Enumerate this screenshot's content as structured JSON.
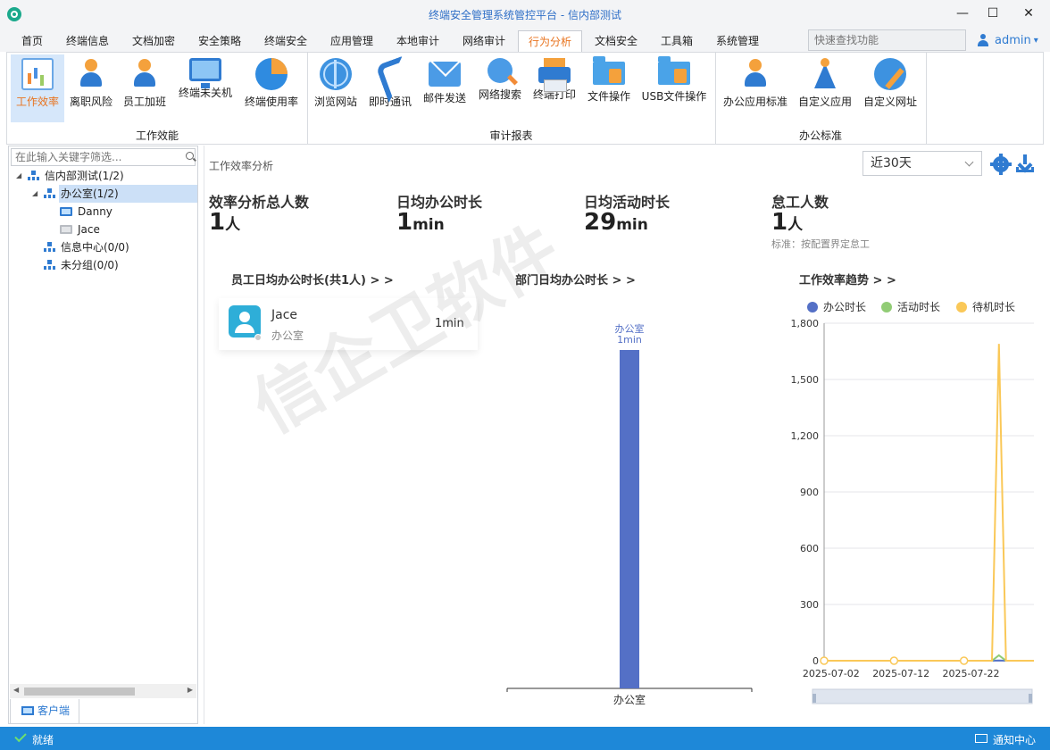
{
  "window": {
    "title": "终端安全管理系统管控平台 - 信内部测试",
    "minimize": "—",
    "maximize": "☐",
    "close": "✕"
  },
  "menu": {
    "items": [
      "首页",
      "终端信息",
      "文档加密",
      "安全策略",
      "终端安全",
      "应用管理",
      "本地审计",
      "网络审计",
      "行为分析",
      "文档安全",
      "工具箱",
      "系统管理"
    ],
    "active": "行为分析",
    "search_placeholder": "快速查找功能",
    "user": "admin",
    "user_caret": "▾"
  },
  "ribbon": {
    "groups": [
      {
        "label": "工作效能",
        "buttons": [
          "工作效率",
          "离职风险",
          "员工加班",
          "终端未关机",
          "终端使用率"
        ]
      },
      {
        "label": "审计报表",
        "buttons": [
          "浏览网站",
          "即时通讯",
          "邮件发送",
          "网络搜索",
          "终端打印",
          "文件操作",
          "USB文件操作"
        ]
      },
      {
        "label": "办公标准",
        "buttons": [
          "办公应用标准",
          "自定义应用",
          "自定义网址"
        ]
      }
    ],
    "active_button": "工作效率"
  },
  "tree": {
    "filter_placeholder": "在此输入关键字筛选...",
    "nodes": [
      {
        "label": "信内部测试(1/2)",
        "type": "org",
        "expanded": true
      },
      {
        "label": "办公室(1/2)",
        "type": "org",
        "expanded": true,
        "selected": true
      },
      {
        "label": "Danny",
        "type": "pc",
        "online": true
      },
      {
        "label": "Jace",
        "type": "pc",
        "online": false
      },
      {
        "label": "信息中心(0/0)",
        "type": "org"
      },
      {
        "label": "未分组(0/0)",
        "type": "org"
      }
    ],
    "caret_expanded": "◢",
    "scroll_left": "◀",
    "scroll_right": "▶",
    "client_tab": "客户端"
  },
  "content": {
    "title": "工作效率分析",
    "range": "近30天",
    "stats": [
      {
        "label": "效率分析总人数",
        "value": "1",
        "unit": "人"
      },
      {
        "label": "日均办公时长",
        "value": "1",
        "unit": "min"
      },
      {
        "label": "日均活动时长",
        "value": "29",
        "unit": "min"
      },
      {
        "label": "怠工人数",
        "value": "1",
        "unit": "人"
      }
    ],
    "slack_note": "标准：按配置界定怠工",
    "sections": {
      "employee": "员工日均办公时长(共1人) > >",
      "department": "部门日均办公时长 > >",
      "trend": "工作效率趋势 > >"
    },
    "employee_card": {
      "name": "Jace",
      "dept": "办公室",
      "time": "1min"
    },
    "watermark": "信企卫软件"
  },
  "chart_data": [
    {
      "type": "bar",
      "categories": [
        "办公室"
      ],
      "values": [
        1
      ],
      "data_labels": [
        "办公室",
        "1min"
      ],
      "unit": "min",
      "color": "#5470c6"
    },
    {
      "type": "line",
      "legend": [
        "办公时长",
        "活动时长",
        "待机时长"
      ],
      "colors": [
        "#5470c6",
        "#91cc75",
        "#fac858"
      ],
      "xticks": [
        "2025-07-02",
        "2025-07-12",
        "2025-07-22"
      ],
      "yticks": [
        "0",
        "300",
        "600",
        "900",
        "1,200",
        "1,500",
        "1,800"
      ],
      "ylim": [
        0,
        1800
      ],
      "xlim": [
        "2025-07-01",
        "2025-07-31"
      ],
      "series": [
        {
          "name": "办公时长",
          "x": [
            "2025-07-01",
            "2025-07-11",
            "2025-07-21",
            "2025-07-25",
            "2025-07-26",
            "2025-07-27",
            "2025-07-31"
          ],
          "y": [
            0,
            0,
            0,
            0,
            1,
            0,
            0
          ]
        },
        {
          "name": "活动时长",
          "x": [
            "2025-07-01",
            "2025-07-11",
            "2025-07-21",
            "2025-07-25",
            "2025-07-26",
            "2025-07-27",
            "2025-07-31"
          ],
          "y": [
            0,
            0,
            0,
            0,
            29,
            0,
            0
          ]
        },
        {
          "name": "待机时长",
          "x": [
            "2025-07-01",
            "2025-07-11",
            "2025-07-21",
            "2025-07-25",
            "2025-07-26",
            "2025-07-27",
            "2025-07-31"
          ],
          "y": [
            0,
            0,
            0,
            0,
            1690,
            0,
            0
          ]
        }
      ],
      "legend_position": "top"
    }
  ],
  "status": {
    "text": "就绪",
    "notify": "通知中心"
  }
}
